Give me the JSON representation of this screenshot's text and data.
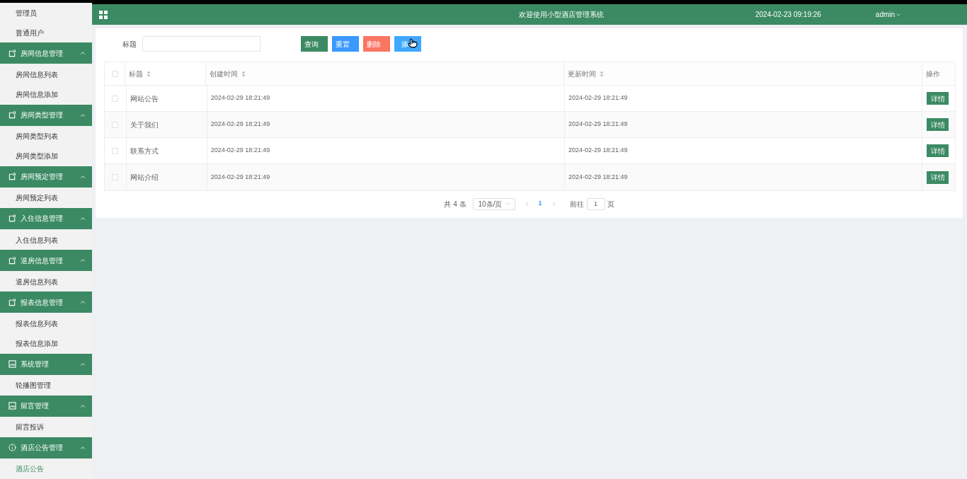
{
  "top_bar": {
    "title": "欢迎使用小型酒店管理系统",
    "datetime": "2024-02-23 09:19:26",
    "user": "admin"
  },
  "sidebar": {
    "items": [
      {
        "kind": "item",
        "label": "管理员",
        "selected": false
      },
      {
        "kind": "item",
        "label": "普通用户",
        "selected": false
      },
      {
        "kind": "group",
        "label": "房间信息管理",
        "expanded": true,
        "children": [
          {
            "label": "房间信息列表",
            "selected": false
          },
          {
            "label": "房间信息添加",
            "selected": false
          }
        ]
      },
      {
        "kind": "group",
        "label": "房间类型管理",
        "expanded": true,
        "children": [
          {
            "label": "房间类型列表",
            "selected": false
          },
          {
            "label": "房间类型添加",
            "selected": false
          }
        ]
      },
      {
        "kind": "group",
        "label": "房间预定管理",
        "expanded": true,
        "children": [
          {
            "label": "房间预定列表",
            "selected": false
          }
        ]
      },
      {
        "kind": "group",
        "label": "入住信息管理",
        "expanded": true,
        "children": [
          {
            "label": "入住信息列表",
            "selected": false
          }
        ]
      },
      {
        "kind": "group",
        "label": "退房信息管理",
        "expanded": true,
        "children": [
          {
            "label": "退房信息列表",
            "selected": false
          }
        ]
      },
      {
        "kind": "group",
        "label": "报表信息管理",
        "expanded": true,
        "children": [
          {
            "label": "报表信息列表",
            "selected": false
          },
          {
            "label": "报表信息添加",
            "selected": false
          }
        ]
      },
      {
        "kind": "group",
        "label": "系统管理",
        "expanded": true,
        "children": [
          {
            "label": "轮播图管理",
            "selected": false
          }
        ]
      },
      {
        "kind": "group",
        "label": "留言管理",
        "expanded": true,
        "children": [
          {
            "label": "留言投诉",
            "selected": false
          }
        ]
      },
      {
        "kind": "group",
        "label": "酒店公告管理",
        "expanded": true,
        "children": [
          {
            "label": "酒店公告",
            "selected": true
          }
        ]
      }
    ]
  },
  "search": {
    "label": "标题"
  },
  "buttons": [
    {
      "kind": "query",
      "label": "查询",
      "hover": false
    },
    {
      "kind": "reset",
      "label": "重置",
      "hover": false
    },
    {
      "kind": "delete",
      "label": "删除",
      "hover": false
    },
    {
      "kind": "add",
      "label": "添",
      "hover": true
    }
  ],
  "table": {
    "select_all": {
      "checked": false
    },
    "columns": [
      {
        "label": "标题",
        "sortable": true
      },
      {
        "label": "创建时间",
        "sortable": true
      },
      {
        "label": "更新时间",
        "sortable": true
      },
      {
        "label": "操作",
        "sortable": false
      }
    ],
    "rows": [
      {
        "checked": false,
        "title": "网站公告",
        "created": "2024-02-29 18:21:49",
        "updated": "2024-02-29 18:21:49",
        "action": "详情"
      },
      {
        "checked": false,
        "title": "关于我们",
        "created": "2024-02-29 18:21:49",
        "updated": "2024-02-29 18:21:49",
        "action": "详情"
      },
      {
        "checked": false,
        "title": "联系方式",
        "created": "2024-02-29 18:21:49",
        "updated": "2024-02-29 18:21:49",
        "action": "详情"
      },
      {
        "checked": false,
        "title": "网站介绍",
        "created": "2024-02-29 18:21:49",
        "updated": "2024-02-29 18:21:49",
        "action": "详情"
      }
    ]
  },
  "pagination": {
    "total": "共 4 条",
    "page_size": "10条/页",
    "pages": [
      {
        "label": "1",
        "selected": true
      }
    ],
    "goto_label": "前往",
    "goto_value": "1",
    "goto_suffix": "页"
  }
}
